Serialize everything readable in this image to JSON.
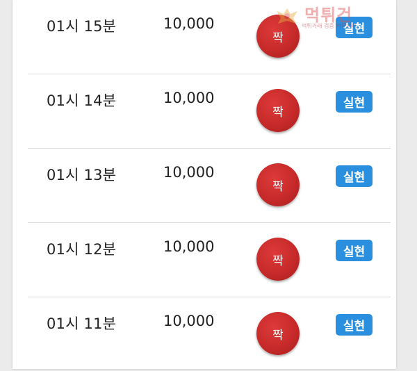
{
  "rows": [
    {
      "time": "01시 15분",
      "amount": "10,000",
      "result": "짝",
      "status": "실현"
    },
    {
      "time": "01시 14분",
      "amount": "10,000",
      "result": "짝",
      "status": "실현"
    },
    {
      "time": "01시 13분",
      "amount": "10,000",
      "result": "짝",
      "status": "실현"
    },
    {
      "time": "01시 12분",
      "amount": "10,000",
      "result": "짝",
      "status": "실현"
    },
    {
      "time": "01시 11분",
      "amount": "10,000",
      "result": "짝",
      "status": "실현"
    }
  ],
  "watermark": {
    "title": "먹튀건",
    "subtitle": "먹튀거래 검증 커뮤니티"
  },
  "colors": {
    "ball": "#c72a2a",
    "badge": "#2a8fdf",
    "background": "#ebebeb"
  }
}
